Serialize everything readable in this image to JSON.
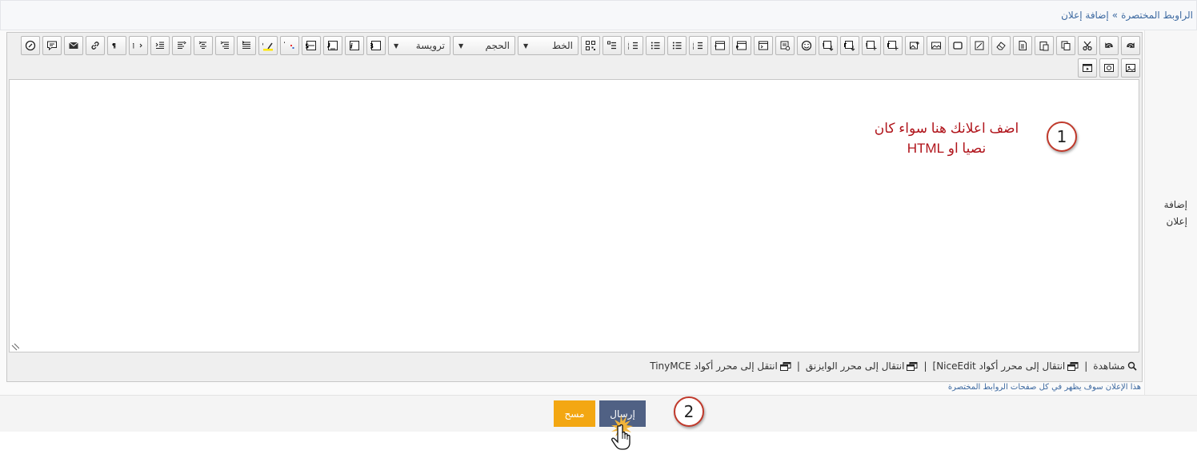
{
  "breadcrumb": {
    "root": "الراوبط المختصرة",
    "separator": "»",
    "current": "إضافة إعلان"
  },
  "field_label_line1": "إضافة",
  "field_label_line2": "إعلان",
  "toolbar": {
    "font_select": "الخط",
    "size_select": "الحجم",
    "heading_select": "ترويسة"
  },
  "annotation": {
    "step1": "1",
    "step2": "2",
    "line1": "اضف اعلانك هنا سواء كان",
    "line2": "نصيا او HTML"
  },
  "editor_links": {
    "preview": "مشاهدة",
    "niceedit": "انتقال إلى محرر أكواد NiceEdit]",
    "wysiwyg": "انتقال إلى محرر الوايزنق",
    "tinymce": "انتقل إلى محرر أكواد TinyMCE"
  },
  "hint": "هذا الإعلان سوف يظهر في كل صفحات الروابط المختصرة",
  "buttons": {
    "submit": "إرسال",
    "reset": "مسح"
  },
  "colors": {
    "submit_bg": "#506184",
    "reset_bg": "#f3a712",
    "annotation_text": "#b0141b",
    "link": "#3e6aa1"
  }
}
